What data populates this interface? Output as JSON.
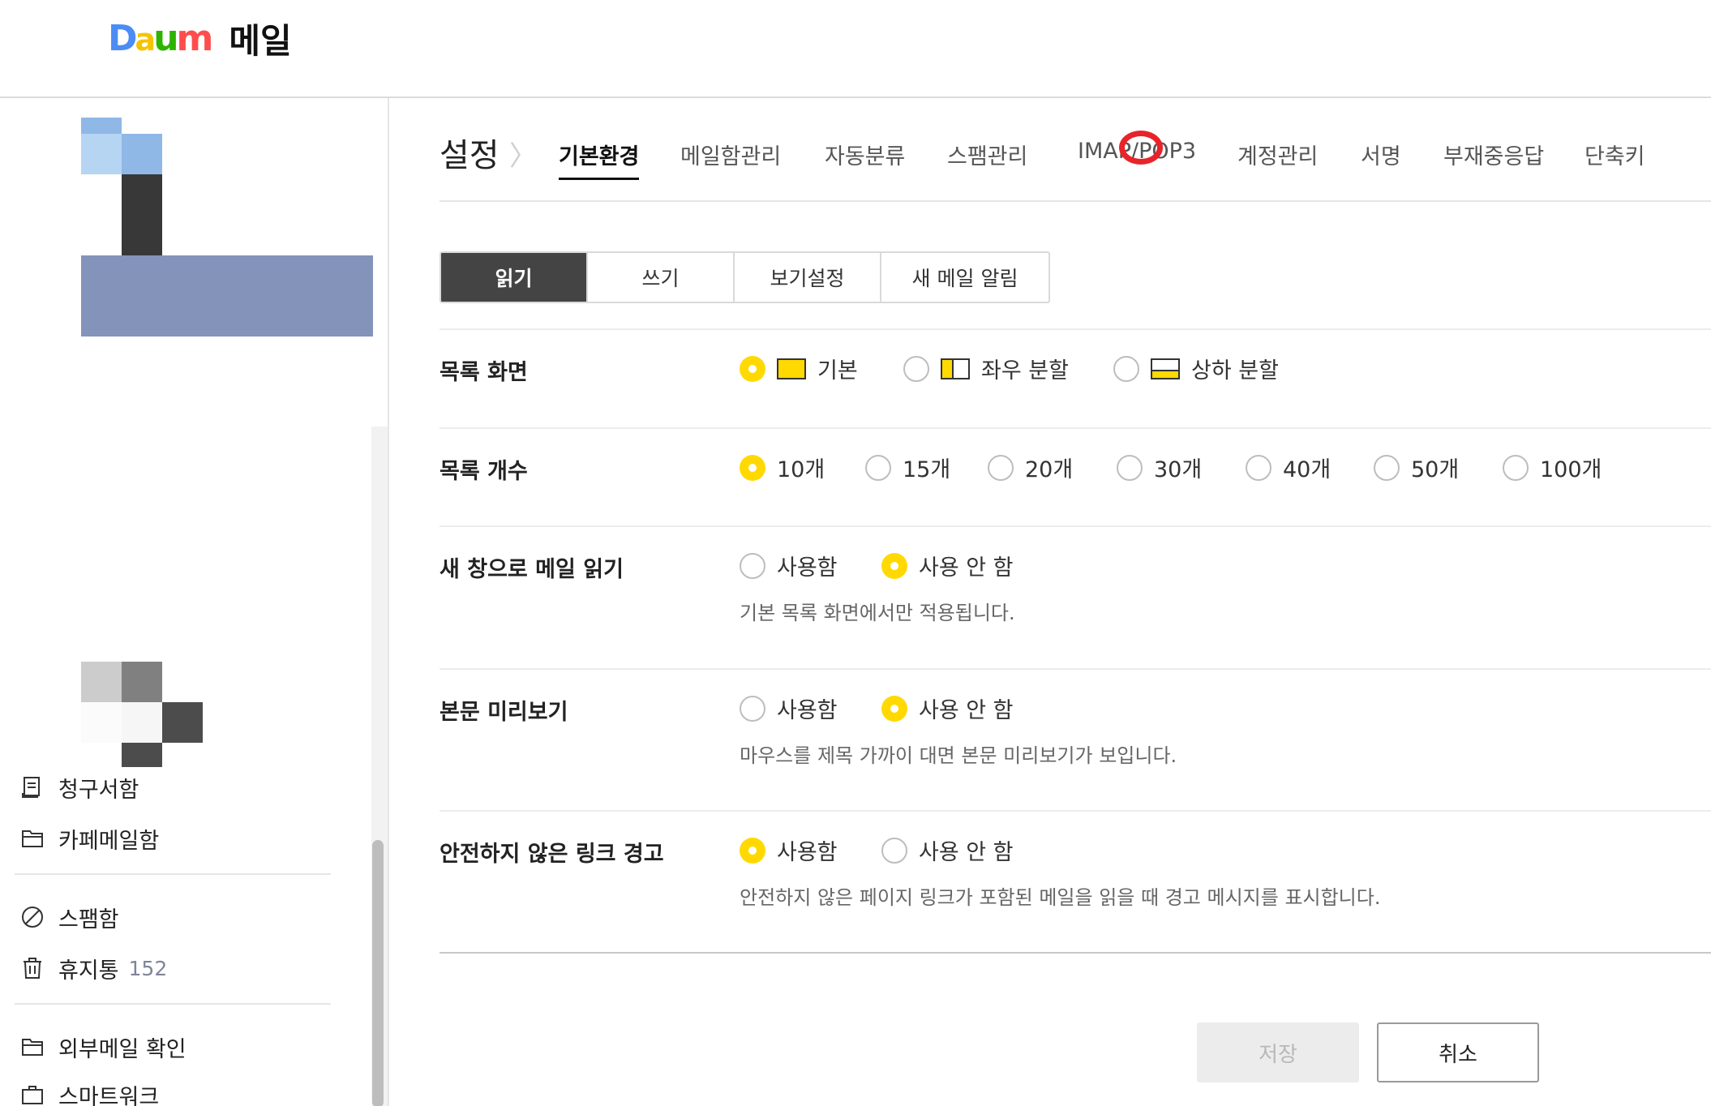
{
  "header": {
    "brand": "Daum",
    "service": "메일"
  },
  "sidebar": {
    "items": [
      {
        "label": "청구서함",
        "icon": "bill-icon",
        "count": ""
      },
      {
        "label": "카페메일함",
        "icon": "folder-icon",
        "count": ""
      },
      {
        "label": "스팸함",
        "icon": "block-icon",
        "count": ""
      },
      {
        "label": "휴지통",
        "icon": "trash-icon",
        "count": "152"
      },
      {
        "label": "외부메일 확인",
        "icon": "folder-icon",
        "count": ""
      },
      {
        "label": "스마트워크",
        "icon": "briefcase-icon",
        "count": ""
      }
    ]
  },
  "main": {
    "title": "설정",
    "crumb_sep": "〉",
    "tabs": [
      "기본환경",
      "메일함관리",
      "자동분류",
      "스팸관리",
      "IMAP/POP3",
      "계정관리",
      "서명",
      "부재중응답",
      "단축키"
    ],
    "active_tab": "기본환경",
    "subtabs": [
      "읽기",
      "쓰기",
      "보기설정",
      "새 메일 알림"
    ],
    "active_subtab": "읽기",
    "settings": {
      "list_view": {
        "label": "목록 화면",
        "options": [
          "기본",
          "좌우 분할",
          "상하 분할"
        ],
        "selected": "기본"
      },
      "list_count": {
        "label": "목록 개수",
        "options": [
          "10개",
          "15개",
          "20개",
          "30개",
          "40개",
          "50개",
          "100개"
        ],
        "selected": "10개"
      },
      "new_window": {
        "label": "새 창으로 메일 읽기",
        "options": [
          "사용함",
          "사용 안 함"
        ],
        "selected": "사용 안 함",
        "desc": "기본 목록 화면에서만 적용됩니다."
      },
      "preview": {
        "label": "본문 미리보기",
        "options": [
          "사용함",
          "사용 안 함"
        ],
        "selected": "사용 안 함",
        "desc": "마우스를 제목 가까이 대면 본문 미리보기가 보입니다."
      },
      "unsafe_link": {
        "label": "안전하지 않은 링크 경고",
        "options": [
          "사용함",
          "사용 안 함"
        ],
        "selected": "사용함",
        "desc": "안전하지 않은 페이지 링크가 포함된 메일을 읽을 때 경고 메시지를 표시합니다."
      }
    },
    "buttons": {
      "save": "저장",
      "cancel": "취소"
    }
  },
  "colors": {
    "accent": "#ffd900",
    "active_subtab_bg": "#444444",
    "annotation_red": "#e8232a",
    "count_gray": "#7f8599"
  }
}
